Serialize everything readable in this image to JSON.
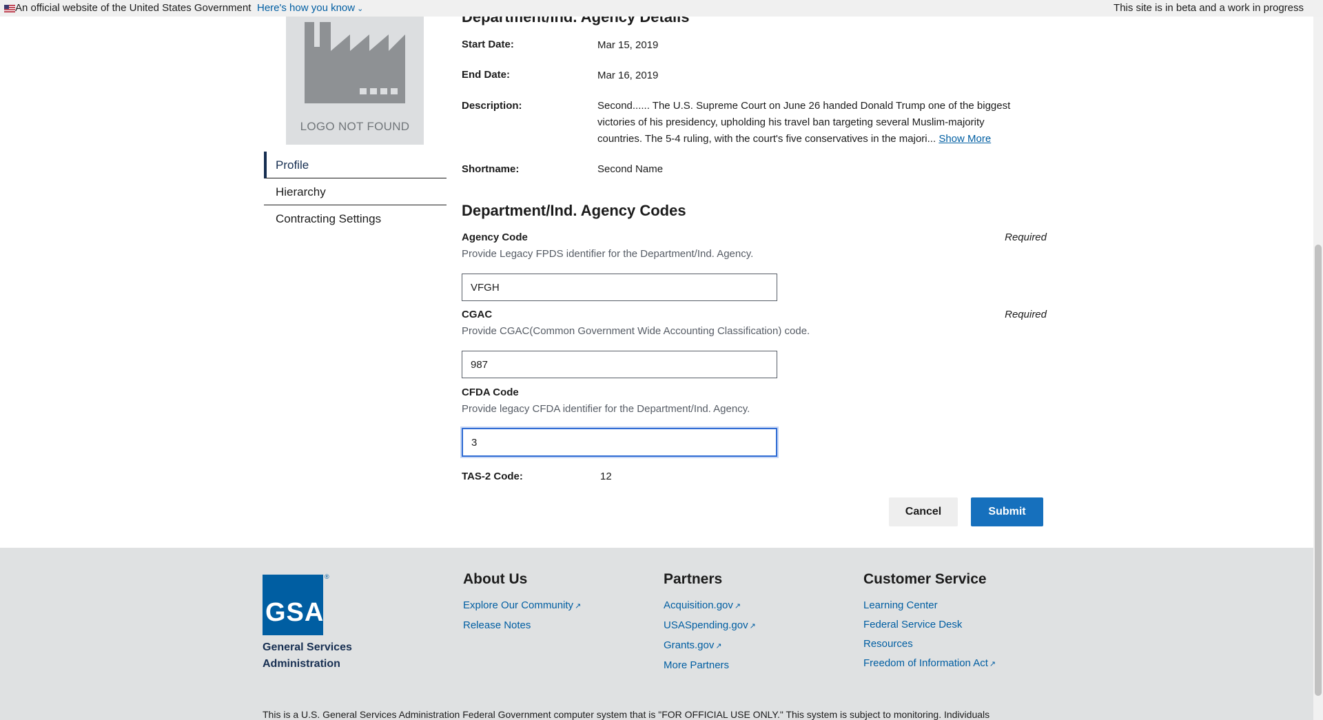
{
  "gov_banner": {
    "official_text": "An official website of the United States Government",
    "how_know_link": "Here's how you know",
    "beta_text": "This site is in beta and a work in progress"
  },
  "logo": {
    "not_found_text": "LOGO NOT FOUND"
  },
  "side_nav": {
    "items": [
      {
        "label": "Profile",
        "active": true
      },
      {
        "label": "Hierarchy",
        "active": false
      },
      {
        "label": "Contracting Settings",
        "active": false
      }
    ]
  },
  "details": {
    "section_title": "Department/Ind. Agency Details",
    "start_date_label": "Start Date:",
    "start_date_value": "Mar 15, 2019",
    "end_date_label": "End Date:",
    "end_date_value": "Mar 16, 2019",
    "description_label": "Description:",
    "description_value": "Second...... The U.S. Supreme Court on June 26 handed Donald Trump one of the biggest victories of his presidency, upholding his travel ban targeting several Muslim-majority countries. The 5-4 ruling, with the court's five conservatives in the majori...",
    "show_more": "Show More",
    "shortname_label": "Shortname:",
    "shortname_value": "Second Name"
  },
  "codes": {
    "section_title": "Department/Ind. Agency Codes",
    "agency_code": {
      "label": "Agency Code",
      "hint": "Provide Legacy FPDS identifier for the Department/Ind. Agency.",
      "required": "Required",
      "value": "VFGH"
    },
    "cgac": {
      "label": "CGAC",
      "hint": "Provide CGAC(Common Government Wide Accounting Classification) code.",
      "required": "Required",
      "value": "987"
    },
    "cfda_code": {
      "label": "CFDA Code",
      "hint": "Provide legacy CFDA identifier for the Department/Ind. Agency.",
      "value": "3"
    },
    "tas2_label": "TAS-2 Code:",
    "tas2_value": "12"
  },
  "actions": {
    "cancel": "Cancel",
    "submit": "Submit"
  },
  "footer": {
    "gsa_logo_text": "GSA",
    "gsa_name": "General Services Administration",
    "about": {
      "title": "About Us",
      "links": [
        "Explore Our Community",
        "Release Notes"
      ]
    },
    "partners": {
      "title": "Partners",
      "links": [
        "Acquisition.gov",
        "USASpending.gov",
        "Grants.gov",
        "More Partners"
      ]
    },
    "customer_service": {
      "title": "Customer Service",
      "links": [
        "Learning Center",
        "Federal Service Desk",
        "Resources",
        "Freedom of Information Act"
      ]
    },
    "notice": "This is a U.S. General Services Administration Federal Government computer system that is \"FOR OFFICIAL USE ONLY.\" This system is subject to monitoring. Individuals"
  }
}
